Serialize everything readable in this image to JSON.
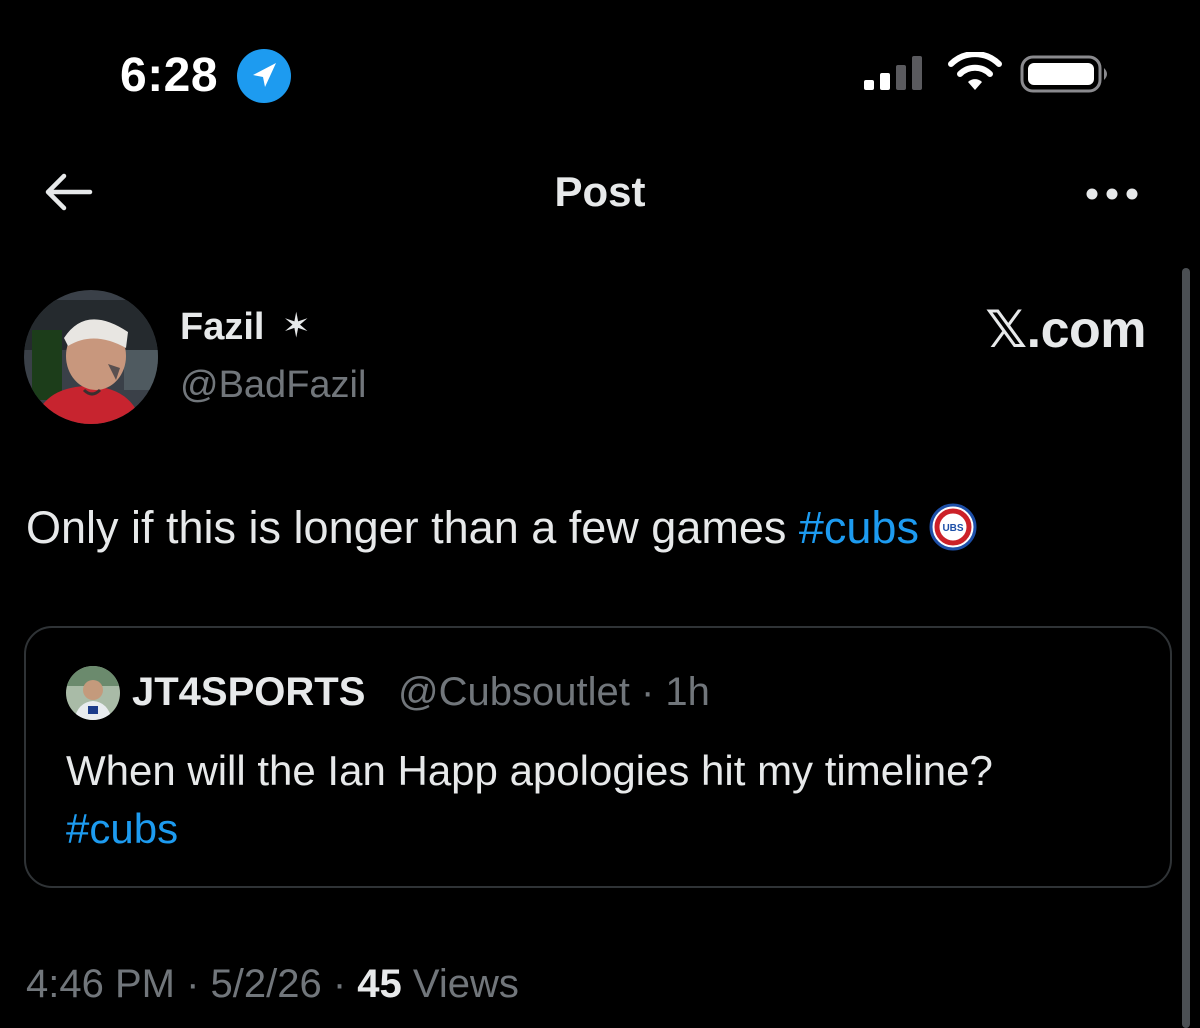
{
  "status_bar": {
    "time": "6:28"
  },
  "header": {
    "title": "Post"
  },
  "post": {
    "author": {
      "name": "Fazil",
      "badge": "✶",
      "handle": "@BadFazil"
    },
    "watermark": "𝕏.com",
    "text": "Only if this is longer than a few games ",
    "hashtag": "#cubs",
    "quoted": {
      "name": "JT4SPORTS",
      "handle": "@Cubsoutlet",
      "separator": " · ",
      "age": "1h",
      "text": "When will the Ian Happ apologies hit my timeline?",
      "hashtag": "#cubs"
    },
    "meta": {
      "time": "4:46 PM",
      "separator": " · ",
      "date": "5/2/26",
      "views_count": "45",
      "views_label": " Views"
    }
  },
  "colors": {
    "background": "#000000",
    "text": "#e7e9ea",
    "muted": "#71767b",
    "link": "#1d9bf0",
    "border": "#2f3336"
  },
  "icons": [
    "location-arrow-icon",
    "signal-icon",
    "wifi-icon",
    "battery-icon",
    "back-arrow-icon",
    "more-icon",
    "cubs-logo-icon"
  ]
}
